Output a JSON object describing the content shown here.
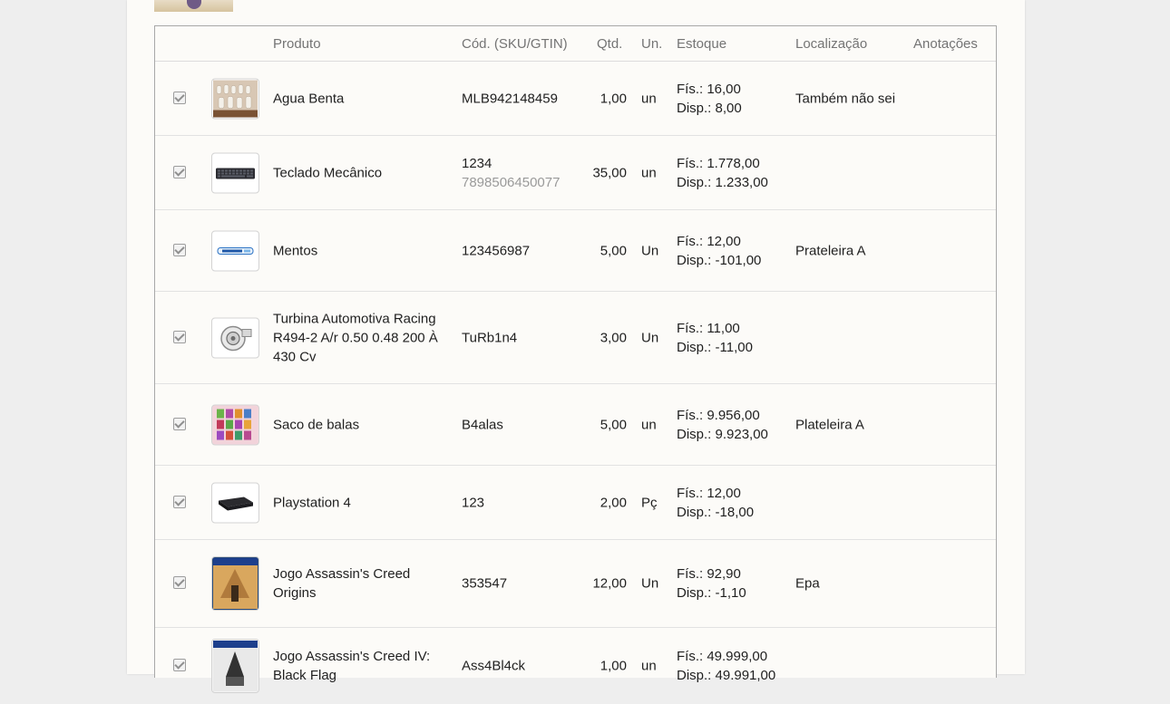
{
  "table": {
    "headers": {
      "produto": "Produto",
      "codigo": "Cód. (SKU/GTIN)",
      "qtd": "Qtd.",
      "un": "Un.",
      "estoque": "Estoque",
      "localizacao": "Localização",
      "anotacoes": "Anotações"
    },
    "rows": [
      {
        "name": "Agua Benta",
        "code": "MLB942148459",
        "code2": "",
        "qty": "1,00",
        "unit": "un",
        "fis": "Fís.: 16,00",
        "disp": "Disp.: 8,00",
        "loc": "Também não sei",
        "thumb_icon": "bottles-thumb-icon"
      },
      {
        "name": "Teclado Mecânico",
        "code": "1234",
        "code2": "7898506450077",
        "qty": "35,00",
        "unit": "un",
        "fis": "Fís.: 1.778,00",
        "disp": "Disp.: 1.233,00",
        "loc": "",
        "thumb_icon": "keyboard-thumb-icon"
      },
      {
        "name": "Mentos",
        "code": "123456987",
        "code2": "",
        "qty": "5,00",
        "unit": "Un",
        "fis": "Fís.: 12,00",
        "disp": "Disp.: -101,00",
        "loc": "Prateleira A",
        "thumb_icon": "candy-pack-thumb-icon"
      },
      {
        "name": "Turbina Automotiva Racing R494-2 A/r 0.50 0.48 200 À 430 Cv",
        "code": "TuRb1n4",
        "code2": "",
        "qty": "3,00",
        "unit": "Un",
        "fis": "Fís.: 11,00",
        "disp": "Disp.: -11,00",
        "loc": "",
        "thumb_icon": "turbo-thumb-icon"
      },
      {
        "name": "Saco de balas",
        "code": "B4alas",
        "code2": "",
        "qty": "5,00",
        "unit": "un",
        "fis": "Fís.: 9.956,00",
        "disp": "Disp.: 9.923,00",
        "loc": "Plateleira A",
        "thumb_icon": "candy-bags-thumb-icon"
      },
      {
        "name": "Playstation 4",
        "code": "123",
        "code2": "",
        "qty": "2,00",
        "unit": "Pç",
        "fis": "Fís.: 12,00",
        "disp": "Disp.: -18,00",
        "loc": "",
        "thumb_icon": "console-thumb-icon"
      },
      {
        "name": "Jogo Assassin's Creed Origins",
        "code": "353547",
        "code2": "",
        "qty": "12,00",
        "unit": "Un",
        "fis": "Fís.: 92,90",
        "disp": "Disp.: -1,10",
        "loc": "Epa",
        "thumb_icon": "game-cover-thumb-icon"
      },
      {
        "name": "Jogo Assassin's Creed IV: Black Flag",
        "code": "Ass4Bl4ck",
        "code2": "",
        "qty": "1,00",
        "unit": "un",
        "fis": "Fís.: 49.999,00",
        "disp": "Disp.: 49.991,00",
        "loc": "",
        "thumb_icon": "game-cover-thumb-icon"
      }
    ]
  }
}
